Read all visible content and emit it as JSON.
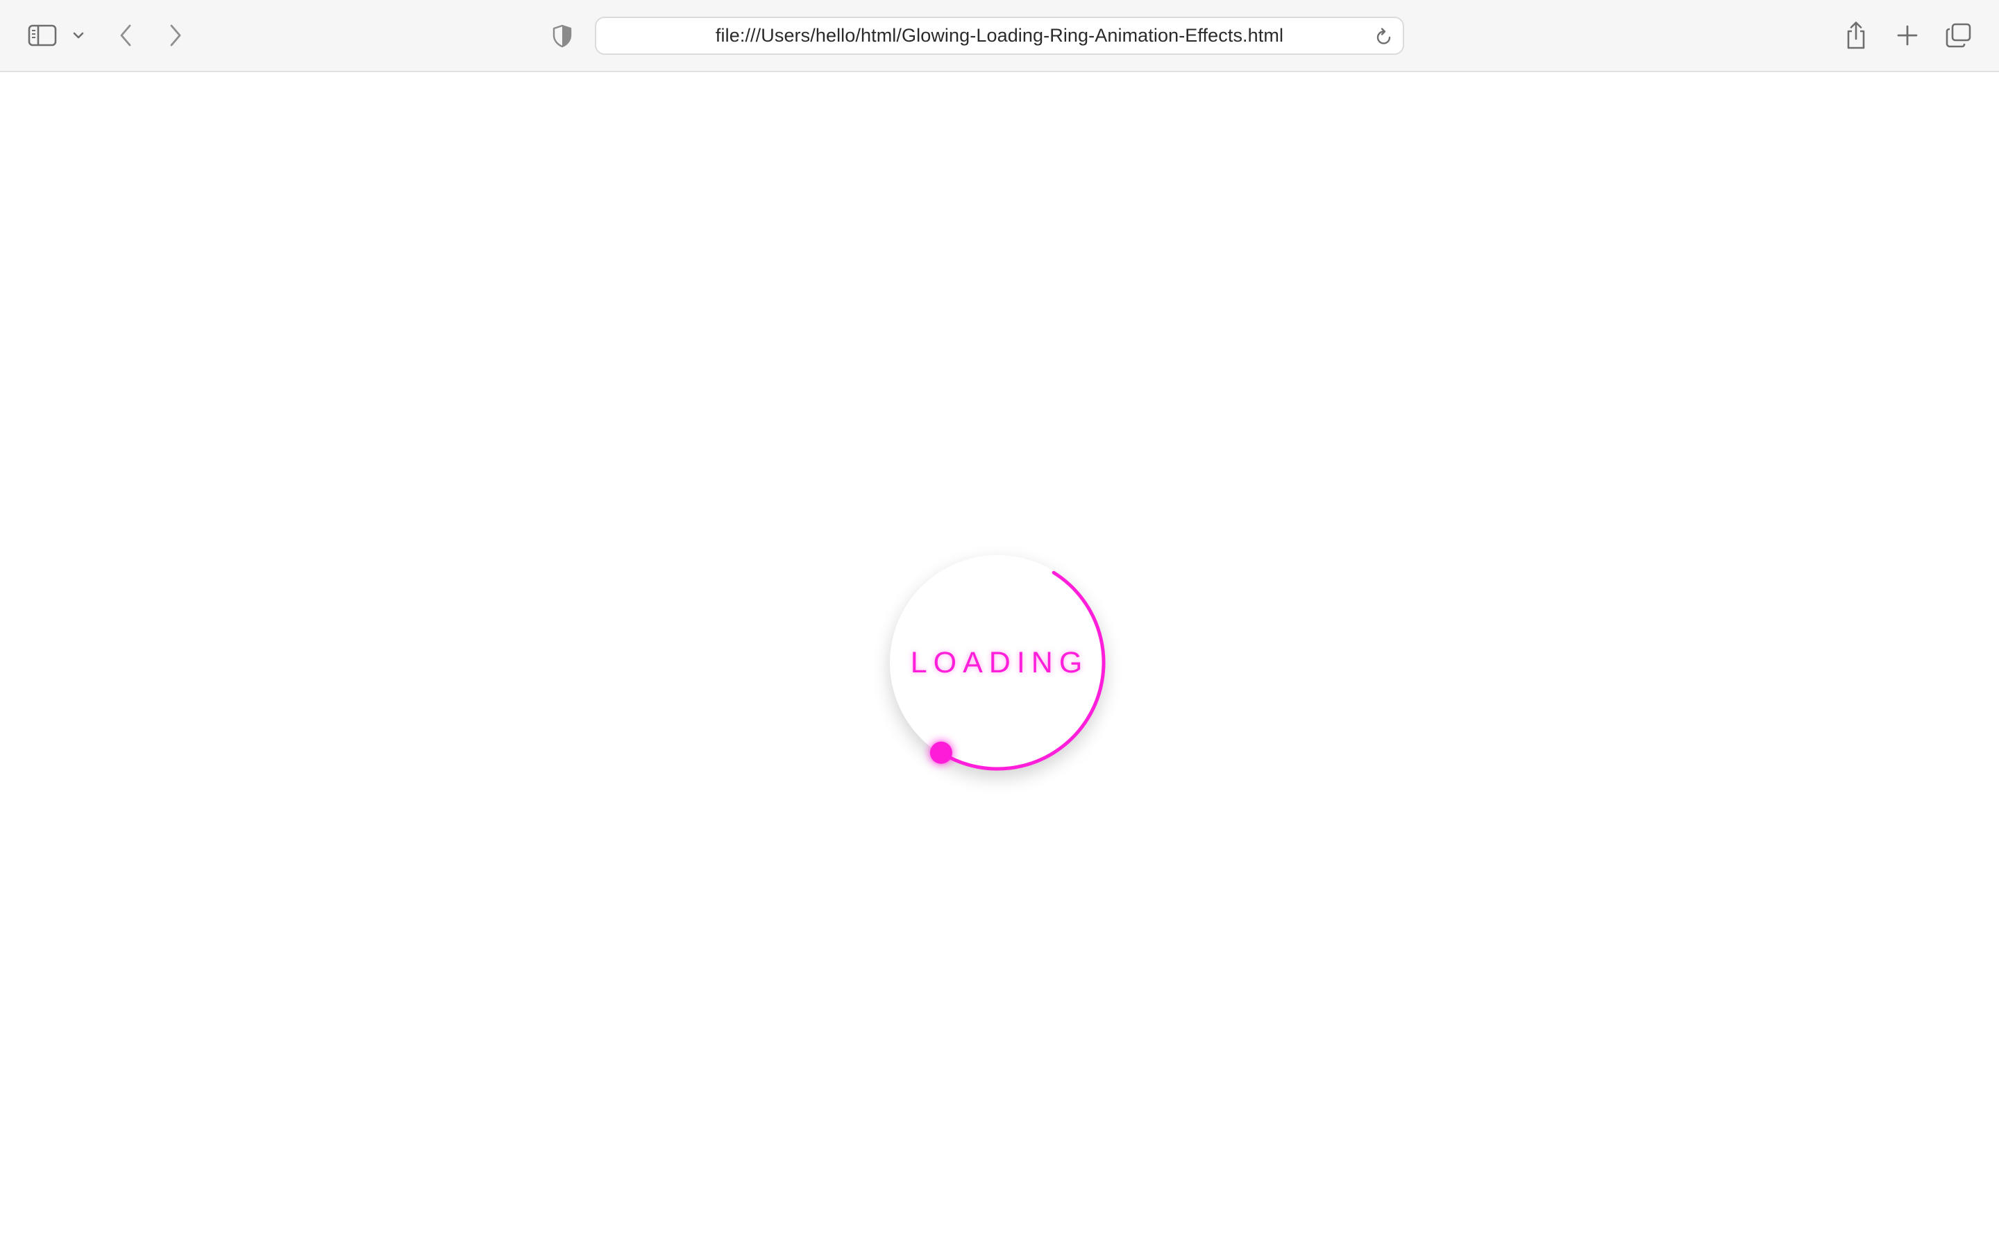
{
  "browser": {
    "url": "file:///Users/hello/html/Glowing-Loading-Ring-Animation-Effects.html",
    "icons": {
      "sidebar": "sidebar-icon",
      "sidebar_menu": "chevron-down-icon",
      "back": "chevron-left-icon",
      "forward": "chevron-right-icon",
      "privacy": "shield-icon",
      "reload": "reload-icon",
      "share": "share-icon",
      "new_tab": "plus-icon",
      "tabs_overview": "tabs-icon"
    }
  },
  "loader": {
    "text": "LOADING",
    "accent_color": "#ff1ed9",
    "ring_fraction": 0.5
  }
}
